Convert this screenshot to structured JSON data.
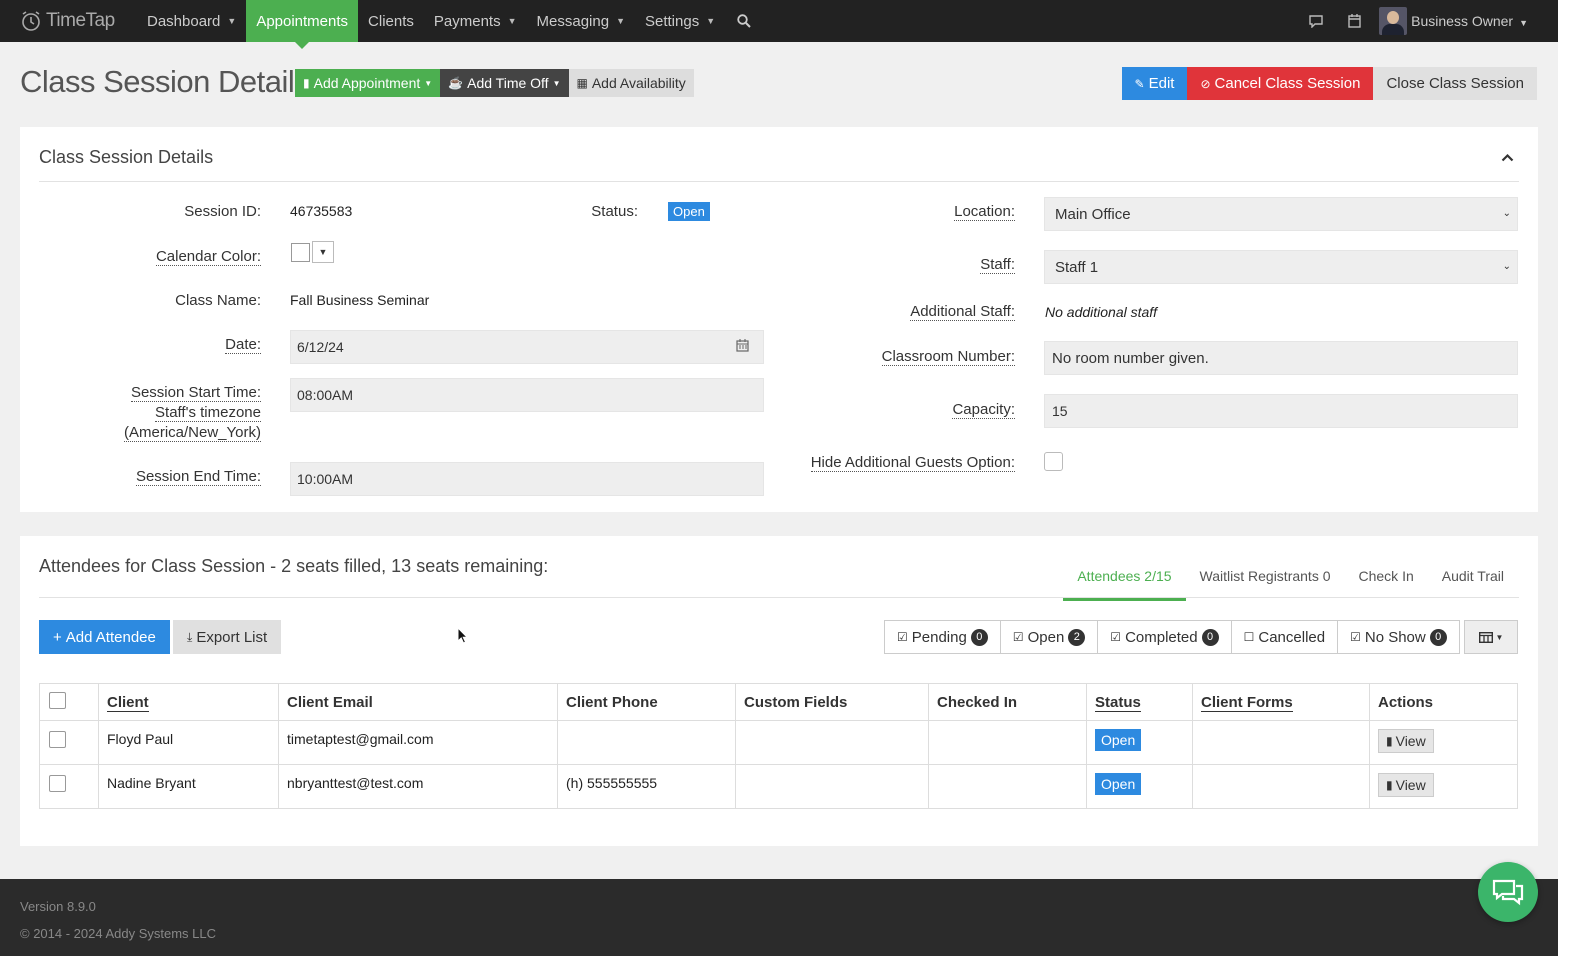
{
  "nav": {
    "logo_text": "TimeTap",
    "items": [
      {
        "label": "Dashboard",
        "dropdown": true
      },
      {
        "label": "Appointments",
        "dropdown": false,
        "active": true
      },
      {
        "label": "Clients",
        "dropdown": false
      },
      {
        "label": "Payments",
        "dropdown": true
      },
      {
        "label": "Messaging",
        "dropdown": true
      },
      {
        "label": "Settings",
        "dropdown": true
      }
    ],
    "user": "Business Owner",
    "accent_color": "#4caf50"
  },
  "header": {
    "title": "Class Session Details",
    "add_appointment": "Add Appointment",
    "add_time_off": "Add Time Off",
    "add_availability": "Add Availability",
    "edit": "Edit",
    "cancel_session": "Cancel Class Session",
    "close_session": "Close Class Session"
  },
  "details": {
    "title": "Class Session Details",
    "session_id_label": "Session ID:",
    "session_id": "46735583",
    "status_label": "Status:",
    "status": "Open",
    "calendar_color_label": "Calendar Color:",
    "class_name_label": "Class Name:",
    "class_name": "Fall Business Seminar",
    "date_label": "Date:",
    "date": "6/12/24",
    "start_label_1": "Session Start Time:",
    "start_label_2": "Staff's timezone",
    "start_label_3": "(America/New_York)",
    "start_time": "08:00AM",
    "end_label": "Session End Time:",
    "end_time": "10:00AM",
    "location_label": "Location:",
    "location": "Main Office",
    "staff_label": "Staff:",
    "staff": "Staff 1",
    "additional_staff_label": "Additional Staff:",
    "additional_staff": "No additional staff",
    "classroom_label": "Classroom Number:",
    "classroom": "No room number given.",
    "capacity_label": "Capacity:",
    "capacity": "15",
    "hide_guests_label": "Hide Additional Guests Option:"
  },
  "attendees": {
    "title": "Attendees for Class Session - 2 seats filled, 13 seats remaining:",
    "tabs": [
      "Attendees 2/15",
      "Waitlist Registrants 0",
      "Check In",
      "Audit Trail"
    ],
    "add_attendee": "Add Attendee",
    "export_list": "Export List",
    "filters": [
      {
        "label": "Pending",
        "checked": true,
        "count": "0"
      },
      {
        "label": "Open",
        "checked": true,
        "count": "2"
      },
      {
        "label": "Completed",
        "checked": true,
        "count": "0"
      },
      {
        "label": "Cancelled",
        "checked": false,
        "count": ""
      },
      {
        "label": "No Show",
        "checked": true,
        "count": "0"
      }
    ],
    "columns": [
      "Client",
      "Client Email",
      "Client Phone",
      "Custom Fields",
      "Checked In",
      "Status",
      "Client Forms",
      "Actions"
    ],
    "rows": [
      {
        "client": "Floyd Paul",
        "email": "timetaptest@gmail.com",
        "phone": "",
        "status": "Open",
        "action": "View"
      },
      {
        "client": "Nadine Bryant",
        "email": "nbryanttest@test.com",
        "phone": "(h) 555555555",
        "status": "Open",
        "action": "View"
      }
    ]
  },
  "footer": {
    "version": "Version 8.9.0",
    "copyright": "© 2014 - 2024 Addy Systems LLC"
  }
}
